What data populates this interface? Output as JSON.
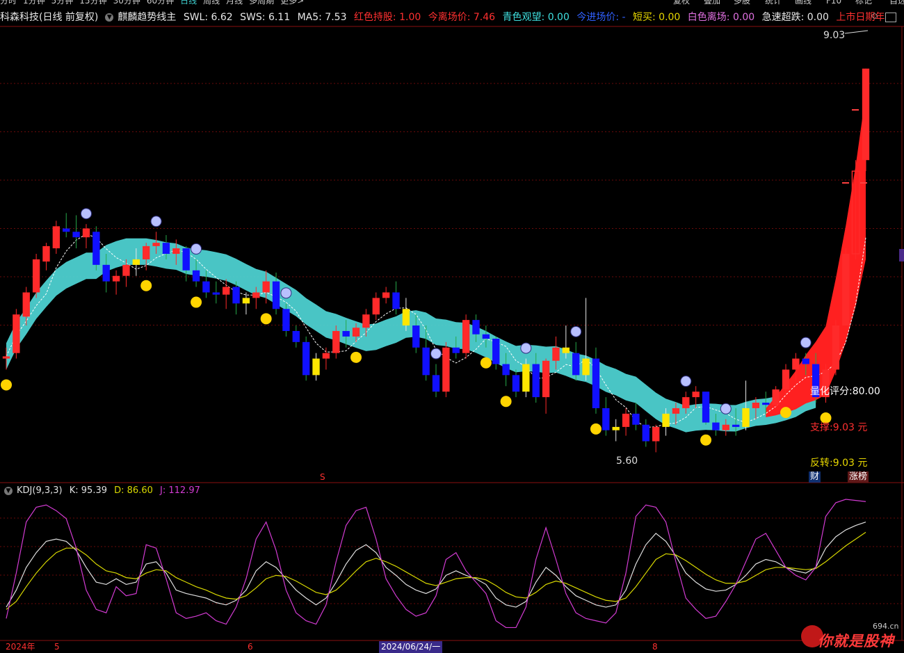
{
  "menu": {
    "items": [
      "分时",
      "1分钟",
      "5分钟",
      "15分钟",
      "30分钟",
      "60分钟",
      "日线",
      "周线",
      "月线",
      "多周期",
      "更多>"
    ],
    "active": "日线",
    "right_items": [
      "复权",
      "叠加",
      "多股",
      "统计",
      "画线",
      "F10",
      "标记",
      "自选"
    ]
  },
  "header": {
    "title": "科森科技(日线 前复权)",
    "indicator_name": "麒麟趋势线主",
    "swl": "SWL: 6.62",
    "sws": "SWS: 6.11",
    "ma5": "MA5: 7.53",
    "hold": "红色持股: 1.00",
    "exit_price": "今离场价: 7.46",
    "watch": "青色观望: 0.00",
    "entry_price": "今进场价: -",
    "short_buy": "短买: 0.00",
    "white_exit": "白色离场: 0.00",
    "sharp_drop": "急速超跌: 0.00",
    "listing_days": "上市日期年"
  },
  "kdj": {
    "name": "KDJ(9,3,3)",
    "k": "K: 95.39",
    "d": "D: 86.60",
    "j": "J: 112.97"
  },
  "annotations": {
    "high_label": "9.03",
    "low_label": "5.60",
    "score": "量化评分:80.00",
    "support": "支撑:9.03 元",
    "reversal": "反转:9.03 元",
    "cai": "财",
    "zhangbang": "涨榜",
    "s_marker": "S"
  },
  "x_axis": {
    "labels": [
      "2024年",
      "5",
      "6",
      "2024/06/24/一",
      "8"
    ]
  },
  "watermark": {
    "site": "694.cn",
    "text": "你就是股神"
  },
  "colors": {
    "up": "#ff2a2a",
    "down": "#1010ff",
    "yellow": "#ffe600",
    "band": "#4fd6d6",
    "k_line": "#e0e0e0",
    "d_line": "#d8d800",
    "j_line": "#d23bd2"
  },
  "chart_data": [
    {
      "type": "candlestick",
      "title": "科森科技(日线 前复权)",
      "ylim": [
        5.3,
        9.4
      ],
      "ohlc": [
        [
          6.4,
          6.5,
          6.3,
          6.42
        ],
        [
          6.45,
          6.85,
          6.4,
          6.8
        ],
        [
          6.78,
          7.05,
          6.7,
          7.0
        ],
        [
          7.0,
          7.35,
          6.95,
          7.3
        ],
        [
          7.28,
          7.45,
          7.2,
          7.42
        ],
        [
          7.4,
          7.65,
          7.35,
          7.6
        ],
        [
          7.58,
          7.72,
          7.5,
          7.55
        ],
        [
          7.55,
          7.7,
          7.4,
          7.5
        ],
        [
          7.5,
          7.62,
          7.4,
          7.58
        ],
        [
          7.55,
          7.6,
          7.2,
          7.25
        ],
        [
          7.25,
          7.35,
          7.0,
          7.1
        ],
        [
          7.1,
          7.2,
          6.98,
          7.15
        ],
        [
          7.15,
          7.3,
          7.05,
          7.25
        ],
        [
          7.25,
          7.4,
          7.15,
          7.3
        ],
        [
          7.3,
          7.45,
          7.2,
          7.42
        ],
        [
          7.42,
          7.55,
          7.35,
          7.45
        ],
        [
          7.45,
          7.52,
          7.3,
          7.35
        ],
        [
          7.35,
          7.48,
          7.25,
          7.4
        ],
        [
          7.4,
          7.42,
          7.1,
          7.2
        ],
        [
          7.2,
          7.3,
          7.05,
          7.1
        ],
        [
          7.1,
          7.2,
          6.95,
          7.0
        ],
        [
          7.0,
          7.1,
          6.9,
          6.98
        ],
        [
          6.98,
          7.12,
          6.85,
          7.05
        ],
        [
          7.05,
          7.1,
          6.8,
          6.9
        ],
        [
          6.9,
          7.0,
          6.8,
          6.95
        ],
        [
          6.95,
          7.05,
          6.85,
          7.0
        ],
        [
          7.0,
          7.2,
          6.9,
          7.1
        ],
        [
          7.1,
          7.18,
          6.8,
          6.85
        ],
        [
          6.85,
          6.9,
          6.6,
          6.65
        ],
        [
          6.65,
          6.7,
          6.5,
          6.55
        ],
        [
          6.55,
          6.6,
          6.2,
          6.25
        ],
        [
          6.25,
          6.45,
          6.2,
          6.4
        ],
        [
          6.4,
          6.5,
          6.3,
          6.45
        ],
        [
          6.45,
          6.7,
          6.4,
          6.65
        ],
        [
          6.65,
          6.75,
          6.5,
          6.6
        ],
        [
          6.6,
          6.72,
          6.55,
          6.68
        ],
        [
          6.68,
          6.85,
          6.6,
          6.8
        ],
        [
          6.8,
          7.0,
          6.75,
          6.95
        ],
        [
          6.95,
          7.05,
          6.9,
          7.0
        ],
        [
          7.0,
          7.1,
          6.8,
          6.85
        ],
        [
          6.85,
          6.95,
          6.65,
          6.7
        ],
        [
          6.7,
          6.8,
          6.45,
          6.5
        ],
        [
          6.5,
          6.7,
          6.2,
          6.25
        ],
        [
          6.25,
          6.35,
          6.05,
          6.1
        ],
        [
          6.1,
          6.55,
          6.05,
          6.5
        ],
        [
          6.5,
          6.6,
          6.4,
          6.45
        ],
        [
          6.45,
          6.8,
          6.4,
          6.75
        ],
        [
          6.75,
          6.8,
          6.55,
          6.62
        ],
        [
          6.62,
          6.7,
          6.5,
          6.58
        ],
        [
          6.58,
          6.6,
          6.3,
          6.35
        ],
        [
          6.35,
          6.45,
          6.15,
          6.25
        ],
        [
          6.25,
          6.3,
          6.05,
          6.1
        ],
        [
          6.1,
          6.4,
          6.05,
          6.35
        ],
        [
          6.35,
          6.45,
          6.0,
          6.05
        ],
        [
          6.05,
          6.4,
          5.9,
          6.38
        ],
        [
          6.38,
          6.6,
          6.3,
          6.5
        ],
        [
          6.5,
          6.7,
          6.4,
          6.45
        ],
        [
          6.45,
          6.55,
          6.2,
          6.25
        ],
        [
          6.25,
          6.95,
          6.2,
          6.4
        ],
        [
          6.4,
          6.5,
          5.9,
          5.95
        ],
        [
          5.95,
          6.05,
          5.7,
          5.75
        ],
        [
          5.75,
          5.85,
          5.65,
          5.78
        ],
        [
          5.78,
          5.95,
          5.7,
          5.9
        ],
        [
          5.9,
          6.0,
          5.75,
          5.8
        ],
        [
          5.8,
          5.85,
          5.6,
          5.65
        ],
        [
          5.65,
          5.8,
          5.55,
          5.78
        ],
        [
          5.78,
          5.95,
          5.7,
          5.9
        ],
        [
          5.9,
          6.0,
          5.8,
          5.95
        ],
        [
          5.95,
          6.1,
          5.9,
          6.05
        ],
        [
          6.05,
          6.15,
          5.95,
          6.1
        ],
        [
          6.1,
          6.08,
          5.8,
          5.82
        ],
        [
          5.82,
          5.9,
          5.7,
          5.75
        ],
        [
          5.75,
          5.85,
          5.7,
          5.8
        ],
        [
          5.8,
          5.95,
          5.7,
          5.78
        ],
        [
          5.78,
          6.2,
          5.75,
          5.95
        ],
        [
          5.95,
          6.05,
          5.85,
          6.0
        ],
        [
          6.0,
          6.1,
          5.9,
          5.98
        ],
        [
          5.98,
          6.15,
          5.95,
          6.12
        ],
        [
          6.12,
          6.35,
          6.05,
          6.3
        ],
        [
          6.3,
          6.45,
          6.2,
          6.4
        ],
        [
          6.4,
          6.45,
          6.25,
          6.35
        ],
        [
          6.35,
          6.45,
          6.0,
          6.05
        ],
        [
          6.05,
          6.35,
          6.0,
          6.3
        ],
        [
          6.3,
          6.75,
          6.25,
          6.7
        ],
        [
          6.7,
          7.4,
          6.7,
          7.35
        ],
        [
          7.35,
          8.2,
          7.3,
          8.1
        ],
        [
          8.2,
          9.03,
          8.1,
          9.03
        ]
      ],
      "support": 9.03,
      "reversal": 9.03,
      "high": 9.03,
      "low": 5.6
    },
    {
      "type": "line",
      "name": "KDJ(9,3,3)",
      "ylim": [
        -10,
        115
      ],
      "series": [
        {
          "name": "K",
          "values": [
            20,
            35,
            55,
            68,
            78,
            80,
            78,
            70,
            55,
            42,
            40,
            45,
            40,
            42,
            58,
            60,
            50,
            35,
            32,
            30,
            28,
            24,
            22,
            26,
            35,
            52,
            60,
            55,
            45,
            35,
            28,
            22,
            28,
            42,
            58,
            70,
            75,
            68,
            55,
            48,
            40,
            35,
            32,
            36,
            48,
            52,
            48,
            45,
            40,
            28,
            22,
            20,
            25,
            42,
            55,
            48,
            38,
            30,
            26,
            22,
            20,
            22,
            35,
            58,
            75,
            85,
            78,
            65,
            50,
            42,
            36,
            34,
            35,
            40,
            48,
            58,
            62,
            60,
            55,
            52,
            50,
            55,
            72,
            82,
            88,
            92,
            95
          ]
        },
        {
          "name": "D",
          "values": [
            18,
            25,
            38,
            50,
            60,
            68,
            72,
            72,
            66,
            58,
            52,
            50,
            46,
            45,
            50,
            53,
            52,
            46,
            42,
            38,
            35,
            31,
            28,
            27,
            30,
            37,
            45,
            48,
            47,
            43,
            38,
            33,
            31,
            35,
            43,
            52,
            60,
            63,
            60,
            56,
            51,
            46,
            41,
            39,
            42,
            45,
            46,
            46,
            44,
            39,
            33,
            29,
            28,
            33,
            40,
            43,
            41,
            37,
            33,
            29,
            26,
            25,
            28,
            38,
            50,
            62,
            67,
            66,
            61,
            55,
            49,
            44,
            41,
            41,
            43,
            48,
            53,
            55,
            55,
            54,
            53,
            54,
            60,
            67,
            74,
            80,
            86
          ]
        },
        {
          "name": "J",
          "values": [
            10,
            50,
            95,
            108,
            110,
            105,
            98,
            72,
            35,
            18,
            15,
            38,
            30,
            32,
            75,
            72,
            45,
            15,
            10,
            12,
            15,
            8,
            5,
            20,
            45,
            80,
            95,
            70,
            35,
            15,
            8,
            5,
            22,
            60,
            92,
            105,
            108,
            80,
            45,
            30,
            18,
            12,
            15,
            30,
            62,
            68,
            52,
            42,
            32,
            8,
            2,
            2,
            20,
            62,
            90,
            62,
            32,
            15,
            10,
            8,
            6,
            15,
            50,
            100,
            110,
            108,
            95,
            60,
            28,
            18,
            10,
            12,
            25,
            40,
            60,
            80,
            85,
            70,
            55,
            48,
            44,
            55,
            100,
            112,
            115,
            114,
            113
          ]
        }
      ]
    }
  ]
}
